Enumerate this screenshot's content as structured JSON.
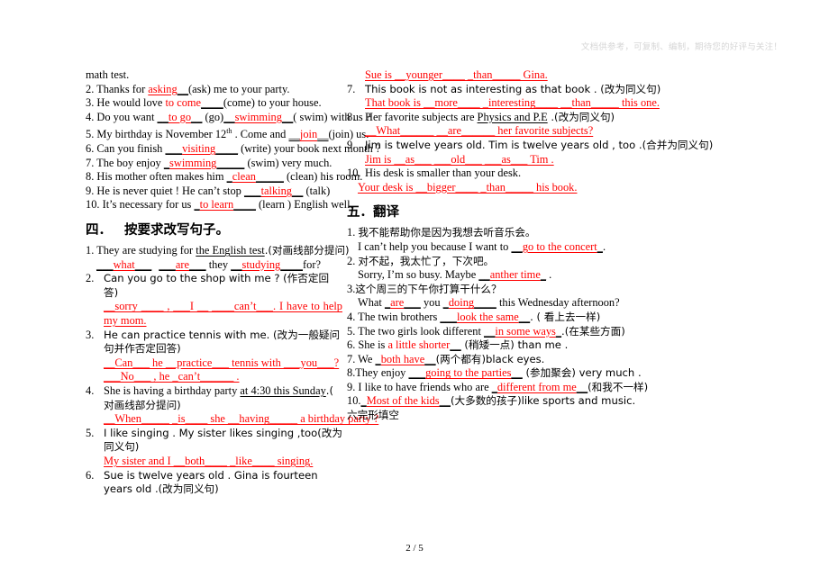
{
  "document": {
    "watermark": "文档供参考，可复制、编制，期待您的好评与关注！",
    "footer": "2 / 5"
  },
  "left_column": {
    "continued_fill_in": {
      "carryover_line": "math test.",
      "items": [
        {
          "num": "2.",
          "pre": "Thanks for ",
          "answer": "asking",
          "blank_after": "__",
          "post": "(ask) me to your party."
        },
        {
          "num": "3.",
          "pre": "He would love ",
          "answer": "to come",
          "blank_after": "____",
          "post": "(come) to your house."
        },
        {
          "num": "4.",
          "pre": "Do you want ",
          "blank_before": "__",
          "answer": "to go",
          "blank_after": "__",
          "mid": " (go)",
          "blank_before2": "__",
          "answer2": "swimming",
          "blank_after2": "__",
          "post": "( swim) with us ?"
        },
        {
          "num": "5.",
          "pre": "My birthday is November 12",
          "sup": "th",
          "mid": " . Come and ",
          "blank_before": "__",
          "answer": "join",
          "blank_after": "__",
          "post": "(join) us."
        },
        {
          "num": "6.",
          "pre": "Can you finish ",
          "blank_before": "___",
          "answer": "visiting",
          "blank_after": "____",
          "post": " (write) your book next month ?"
        },
        {
          "num": "7.",
          "pre": "The boy enjoy ",
          "blank_before": "_",
          "answer": "swimming",
          "blank_after": "_____",
          "post": " (swim) very much."
        },
        {
          "num": "8.",
          "pre": "His mother often makes him ",
          "blank_before": "_",
          "answer": "clean",
          "blank_after": "_____",
          "post": " (clean) his room."
        },
        {
          "num": "9.",
          "pre": "He is never quiet ! He can’t stop ",
          "blank_before": "___",
          "answer": "talking",
          "blank_after": "__",
          "post": " (talk)"
        },
        {
          "num": "10.",
          "pre": "It’s necessary for us ",
          "blank_before": "_",
          "answer": "to learn",
          "blank_after": "____",
          "post": " (learn ) English well."
        }
      ]
    },
    "section_four": {
      "heading_num": "四．",
      "heading_text": "按要求改写句子。",
      "items": [
        {
          "num": "1.",
          "question_pre": "They are studying for ",
          "question_underlined": "the English test",
          "question_post": ".(对画线部分提问)",
          "answer_parts": [
            {
              "blank": "___",
              "text": "what",
              "blank2": "___"
            },
            {
              "blank": "___",
              "text": "are",
              "blank2": "___"
            },
            {
              "plain": " they "
            },
            {
              "blank": "__",
              "text": "studying",
              "blank2": "____"
            },
            {
              "plain": "for?"
            }
          ]
        },
        {
          "num": "2.",
          "question": "Can you go to the shop with me ? (作否定回答)",
          "answer_line": "__sorry ____ ,  ___I __ ____can’t___. I have to help my mom."
        },
        {
          "num": "3.",
          "question": "He can practice tennis with me. (改为一般疑问句并作否定回答)",
          "answer_line_1": "__Can___    he __practice___  tennis  with  ___you___?",
          "answer_line_2": "___No___ , he _can’t______ ."
        },
        {
          "num": "4.",
          "question_pre": "She is having a birthday party ",
          "question_underlined": "at 4:30 this Sunday",
          "question_post": ".( 对画线部分提问)",
          "answer_line": "__When_____ _is____ she __having_____ a birthday party ?"
        },
        {
          "num": "5.",
          "question": "I like singing . My sister likes singing ,too(改为同义句)",
          "answer_line": "My sister and I __both____ _like____ singing."
        },
        {
          "num": "6.",
          "question": "Sue is twelve years old . Gina is fourteen years old .(改为同义句)"
        }
      ]
    }
  },
  "right_column": {
    "section_four_continued": {
      "item6_answer": "Sue is __younger____ _than_____ Gina.",
      "items": [
        {
          "num": "7.",
          "question": "This book is not as interesting as that book . (改为同义句)",
          "answer_line": "That book is __more____ _interesting____ __than_____ this one."
        },
        {
          "num": "8.",
          "question_pre": "Her favorite subjects are ",
          "question_underlined": "Physics and P.E",
          "question_post": " .(改为同义句)",
          "answer_line": "__What______ __are______ her favorite subjects?"
        },
        {
          "num": "9.",
          "question": "Jim is twelve years old. Tim is twelve years old , too .(合并为同义句)",
          "answer_line": "Jim is __as___ ___old___ ___as___ Tim ."
        },
        {
          "num": "10.",
          "question": "His desk is smaller than your desk.",
          "answer_line": "Your desk is __bigger____ _than_____ his book."
        }
      ]
    },
    "section_five": {
      "heading_num": "五．",
      "heading_text": "翻译",
      "items": [
        {
          "num": "1.",
          "chinese": "我不能帮助你是因为我想去听音乐会。",
          "pre": "I can’t help you because I want to ",
          "blank_before": "__",
          "answer": "go to the concert",
          "blank_after": "_",
          "post": "."
        },
        {
          "num": "2.",
          "chinese": "对不起，我太忙了，下次吧。",
          "pre": "Sorry, I’m so busy. Maybe ",
          "blank_before": "__",
          "answer": "anther time",
          "blank_after": "_",
          "post": " ."
        },
        {
          "num": "3.",
          "chinese": "这个周三的下午你打算干什么？",
          "pre": "What ",
          "blank_before": "_",
          "answer": "are",
          "blank_after": "___",
          "mid": " you ",
          "blank_before2": "_",
          "answer2": "doing",
          "blank_after2": "____",
          "post": " this Wednesday afternoon?"
        },
        {
          "num": "4.",
          "pre": "The twin brothers ",
          "blank_before": "___",
          "answer": "look the same",
          "blank_after": "__",
          "post": ". ( 看上去一样)"
        },
        {
          "num": "5.",
          "pre": "The two girls look different ",
          "blank_before": "__",
          "answer": "in some ways",
          "blank_after": "_",
          "post": ".(在某些方面)"
        },
        {
          "num": "6.",
          "pre": "She is ",
          "answer": "a little shorter",
          "blank_after": "__",
          "post": " (稍矮一点) than me ."
        },
        {
          "num": "7.",
          "pre": "We ",
          "blank_before": "_",
          "answer": "both have",
          "blank_after": "__",
          "post": "(两个都有)black eyes."
        },
        {
          "num": "8.",
          "pre": "They enjoy ",
          "blank_before": "___",
          "answer": "going to the parties",
          "blank_after": "__",
          "post": " (参加聚会) very much ."
        },
        {
          "num": "9.",
          "pre": "I like to have friends who are ",
          "blank_before": "_",
          "answer": "different from me",
          "blank_after": "__",
          "post": "(和我不一样)"
        },
        {
          "num": "10.",
          "blank_before": "_",
          "answer": "Most of the kids",
          "blank_after": "__",
          "post": "(大多数的孩子)like sports and music."
        }
      ],
      "next_section_label": "六完形填空"
    }
  }
}
